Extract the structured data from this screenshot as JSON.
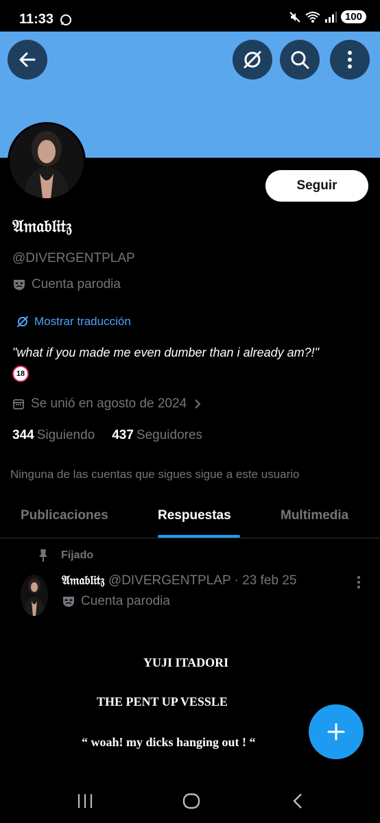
{
  "status_bar": {
    "time": "11:33",
    "battery": "100"
  },
  "profile": {
    "display_name": "𝔄𝔪𝔞𝔟𝔩𝔦𝔱𝔷",
    "handle": "@DIVERGENTPLAP",
    "parody_label": "Cuenta parodia",
    "translate_link": "Mostrar traducción",
    "bio": "\"what if you made me even dumber than i already am?!\"",
    "bio_emoji": "18",
    "joined": "Se unió en agosto de 2024",
    "following_count": "344",
    "following_label": "Siguiendo",
    "followers_count": "437",
    "followers_label": "Seguidores",
    "no_mutuals": "Ninguna de las cuentas que sigues sigue a este usuario",
    "follow_button": "Seguir"
  },
  "tabs": [
    {
      "label": "Publicaciones",
      "active": false
    },
    {
      "label": "Respuestas",
      "active": true
    },
    {
      "label": "Multimedia",
      "active": false
    }
  ],
  "pinned_post": {
    "pinned_label": "Fijado",
    "author_name": "𝔄𝔪𝔞𝔟𝔩𝔦𝔱𝔷",
    "author_handle": "@DIVERGENTPLAP",
    "date": "23 feb 25",
    "parody_label": "Cuenta parodia",
    "lines": [
      "YUJI ITADORI",
      "THE PENT UP VESSLE",
      "“ woah! my dicks hanging out ! “"
    ]
  },
  "colors": {
    "banner": "#5aa7ee",
    "accent": "#1d9bf0",
    "link": "#4da3ff",
    "muted": "#71767b"
  },
  "icons": [
    "back-arrow-icon",
    "translate-icon",
    "search-icon",
    "more-vertical-icon",
    "mask-icon",
    "calendar-icon",
    "chevron-right-icon",
    "pin-icon",
    "plus-icon"
  ]
}
